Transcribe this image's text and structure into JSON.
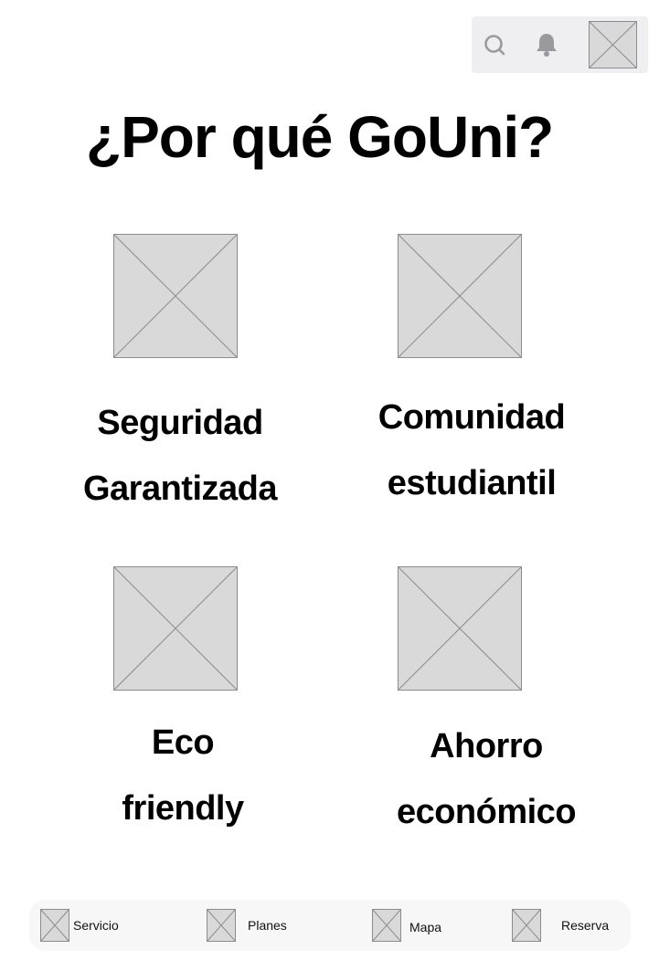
{
  "header": {
    "icons": [
      "search-icon",
      "bell-icon",
      "avatar-placeholder"
    ]
  },
  "page": {
    "title": "¿Por qué GoUni?"
  },
  "features": [
    {
      "line1": "Seguridad",
      "line2": "Garantizada",
      "image": "image-placeholder"
    },
    {
      "line1": "Comunidad",
      "line2": "estudiantil",
      "image": "image-placeholder"
    },
    {
      "line1": "Eco",
      "line2": "friendly",
      "image": "image-placeholder"
    },
    {
      "line1": "Ahorro",
      "line2": "económico",
      "image": "image-placeholder"
    }
  ],
  "bottom_nav": {
    "items": [
      {
        "label": "Servicio",
        "icon": "image-placeholder-icon"
      },
      {
        "label": "Planes",
        "icon": "image-placeholder-icon"
      },
      {
        "label": "Mapa",
        "icon": "image-placeholder-icon"
      },
      {
        "label": "Reserva",
        "icon": "image-placeholder-icon"
      }
    ]
  },
  "colors": {
    "placeholder_fill": "#d9d9d9",
    "placeholder_stroke": "#8c8c8c",
    "topbar_bg": "#efeff1",
    "icon_gray": "#9a9a9e",
    "nav_bg": "#f7f7f8"
  }
}
